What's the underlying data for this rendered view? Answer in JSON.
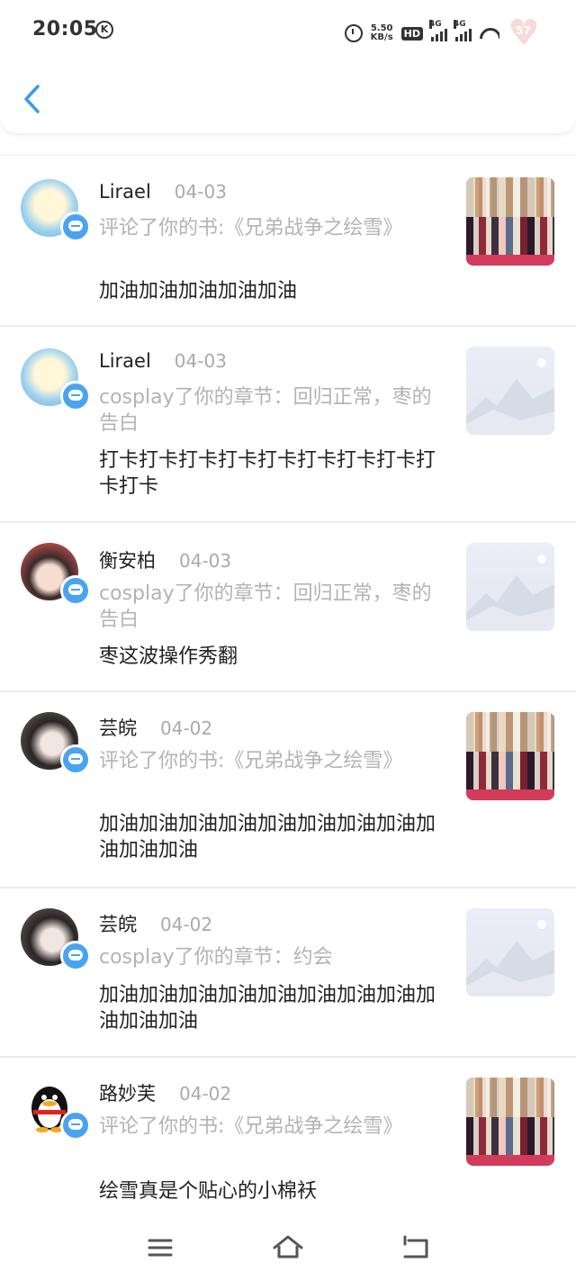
{
  "status_bar": {
    "time": "20:05",
    "k_icon": "K",
    "speed_value": "5.50",
    "speed_unit": "KB/s",
    "hd_label": "HD",
    "sim1_label": "4G",
    "sim2_label": "4G",
    "battery_level": "57"
  },
  "header": {
    "back_icon": "chevron-left-icon"
  },
  "notifications": [
    {
      "username": "Lirael",
      "date": "04-03",
      "action": "评论了你的书:《兄弟战争之绘雪》",
      "message": "加油加油加油加油加油",
      "thumbnail": "book-cover"
    },
    {
      "username": "Lirael",
      "date": "04-03",
      "action": "cosplay了你的章节：回归正常，枣的告白",
      "message": "打卡打卡打卡打卡打卡打卡打卡打卡打卡打卡",
      "thumbnail": "placeholder"
    },
    {
      "username": "衡安柏",
      "date": "04-03",
      "action": "cosplay了你的章节：回归正常，枣的告白",
      "message": "枣这波操作秀翻",
      "thumbnail": "placeholder"
    },
    {
      "username": "芸皖",
      "date": "04-02",
      "action": "评论了你的书:《兄弟战争之绘雪》",
      "message": "加油加油加油加油加油加油加油加油加油加油加油",
      "thumbnail": "book-cover"
    },
    {
      "username": "芸皖",
      "date": "04-02",
      "action": "cosplay了你的章节：约会",
      "message": "加油加油加油加油加油加油加油加油加油加油加油",
      "thumbnail": "placeholder"
    },
    {
      "username": "路妙芙",
      "date": "04-02",
      "action": "评论了你的书:《兄弟战争之绘雪》",
      "message": "绘雪真是个贴心的小棉袄",
      "thumbnail": "book-cover"
    }
  ],
  "colors": {
    "accent": "#4aa3f0",
    "muted_text": "#b3b3b3",
    "divider": "#ececec"
  },
  "nav_bar": {
    "menu_icon": "menu-icon",
    "home_icon": "home-icon",
    "back_icon": "back-nav-icon"
  }
}
